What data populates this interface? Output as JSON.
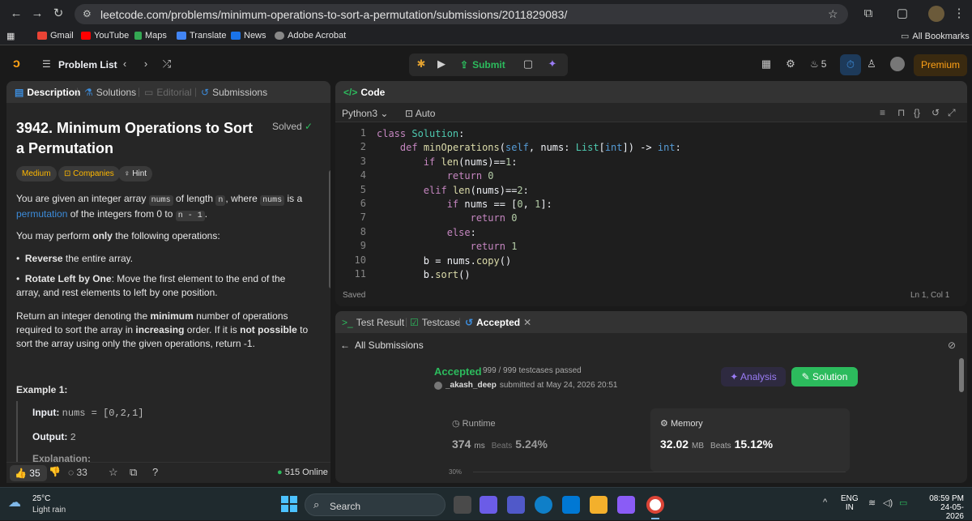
{
  "browser": {
    "url": "leetcode.com/problems/minimum-operations-to-sort-a-permutation/submissions/2011829083/",
    "bookmarks": [
      "Gmail",
      "YouTube",
      "Maps",
      "Translate",
      "News",
      "Adobe Acrobat"
    ],
    "all_bookmarks": "All Bookmarks"
  },
  "nav": {
    "problem_list": "Problem List",
    "submit": "Submit",
    "streak": "5",
    "premium": "Premium"
  },
  "left": {
    "tabs": [
      "Description",
      "Solutions",
      "Editorial",
      "Submissions"
    ],
    "title": "3942. Minimum Operations to Sort a Permutation",
    "solved": "Solved",
    "difficulty": "Medium",
    "companies": "Companies",
    "hint": "Hint",
    "p1_a": "You are given an integer array ",
    "p1_nums": "nums",
    "p1_b": " of length ",
    "p1_n": "n",
    "p1_c": ", where ",
    "p1_d": " is a",
    "p1_link": "permutation",
    "p1_e": " of the integers from 0 to ",
    "p1_code": "n - 1",
    "p1_f": ".",
    "p2_a": "You may perform ",
    "p2_b": "only",
    "p2_c": " the following operations:",
    "b1_bold": "Reverse",
    "b1_rest": " the entire array.",
    "b2_bold": "Rotate Left by One",
    "b2_rest": ": Move the first element to the end of the array, and rest elements to left by one position.",
    "p3_a": "Return an integer denoting the ",
    "p3_b": "minimum",
    "p3_c": " number of operations required to sort the array in ",
    "p3_d": "increasing",
    "p3_e": " order. If it is ",
    "p3_f": "not possible",
    "p3_g": " to sort the array using only the given operations, return -1.",
    "example_title": "Example 1:",
    "ex_input_label": "Input:",
    "ex_input": "nums = [0,2,1]",
    "ex_output_label": "Output:",
    "ex_output": "2",
    "ex_expl": "Explanation:",
    "likes": "35",
    "comments": "33",
    "online": "515 Online"
  },
  "code": {
    "header": "Code",
    "language": "Python3",
    "mode": "Auto",
    "saved": "Saved",
    "cursor": "Ln 1, Col 1",
    "lines": [
      "class Solution:",
      "    def minOperations(self, nums: List[int]) -> int:",
      "        if len(nums)==1:",
      "            return 0",
      "        elif len(nums)==2:",
      "            if nums == [0, 1]:",
      "                return 0",
      "            else:",
      "                return 1",
      "        b = nums.copy()",
      "        b.sort()"
    ],
    "line_numbers": [
      "1",
      "2",
      "3",
      "4",
      "5",
      "6",
      "7",
      "8",
      "9",
      "10",
      "11"
    ]
  },
  "result": {
    "tabs": [
      "Test Result",
      "Testcase",
      "Accepted"
    ],
    "all_submissions": "All Submissions",
    "status": "Accepted",
    "passed": "999 / 999 testcases passed",
    "user": "_akash_deep",
    "submitted": "submitted at May 24, 2026 20:51",
    "analysis": "Analysis",
    "solution": "Solution",
    "runtime_label": "Runtime",
    "runtime_value": "374",
    "runtime_unit": "ms",
    "runtime_beats_label": "Beats",
    "runtime_beats": "5.24%",
    "memory_label": "Memory",
    "memory_value": "32.02",
    "memory_unit": "MB",
    "memory_beats_label": "Beats",
    "memory_beats": "15.12%",
    "chart_tick": "30%"
  },
  "taskbar": {
    "temp": "25°C",
    "weather": "Light rain",
    "search": "Search",
    "lang1": "ENG",
    "lang2": "IN",
    "time": "08:59 PM",
    "date": "24-05-2026"
  }
}
